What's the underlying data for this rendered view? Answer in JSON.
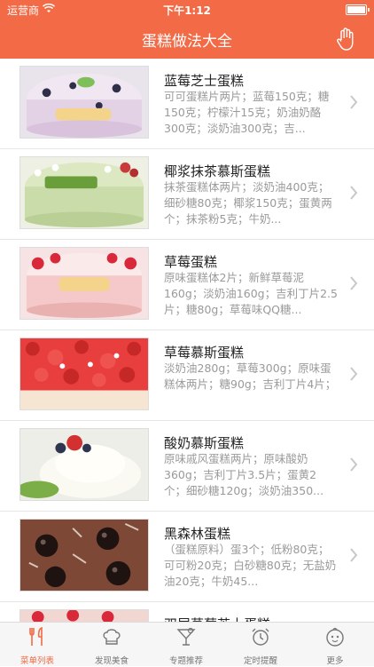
{
  "status": {
    "carrier": "运营商",
    "time": "下午1:12"
  },
  "navbar": {
    "title": "蛋糕做法大全",
    "icon": "hand-icon"
  },
  "recipes": [
    {
      "name": "蓝莓芝士蛋糕",
      "desc": "可可蛋糕片两片；蓝莓150克；糖150克；柠檬汁15克；奶油奶酪300克；淡奶油300克；吉..."
    },
    {
      "name": "椰浆抹茶慕斯蛋糕",
      "desc": "抹茶蛋糕体两片；淡奶油400克；细砂糖80克；椰浆150克；蛋黄两个；抹茶粉5克；牛奶..."
    },
    {
      "name": "草莓蛋糕",
      "desc": "原味蛋糕体2片；新鲜草莓泥160g；淡奶油160g；吉利丁片2.5片；糖80g；草莓味QQ糖..."
    },
    {
      "name": "草莓慕斯蛋糕",
      "desc": "淡奶油280g；草莓300g；原味蛋糕体两片；糖90g；吉利丁片4片；"
    },
    {
      "name": "酸奶慕斯蛋糕",
      "desc": "原味戚风蛋糕两片；原味酸奶360g；吉利丁片3.5片；蛋黄2个；细砂糖120g；淡奶油350..."
    },
    {
      "name": "黑森林蛋糕",
      "desc": "（蛋糕原料）蛋3个；低粉80克；可可粉20克；白砂糖80克；无盐奶油20克；牛奶45..."
    },
    {
      "name": "双层草莓芝士蛋糕",
      "desc": ""
    }
  ],
  "tabs": [
    {
      "label": "菜单列表",
      "icon": "fork-knife-icon",
      "active": true
    },
    {
      "label": "发现美食",
      "icon": "chef-hat-icon",
      "active": false
    },
    {
      "label": "专题推荐",
      "icon": "cocktail-icon",
      "active": false
    },
    {
      "label": "定时提醒",
      "icon": "alarm-clock-icon",
      "active": false
    },
    {
      "label": "更多",
      "icon": "face-icon",
      "active": false
    }
  ],
  "colors": {
    "accent": "#f26a46",
    "text_secondary": "#9a9a9a"
  }
}
